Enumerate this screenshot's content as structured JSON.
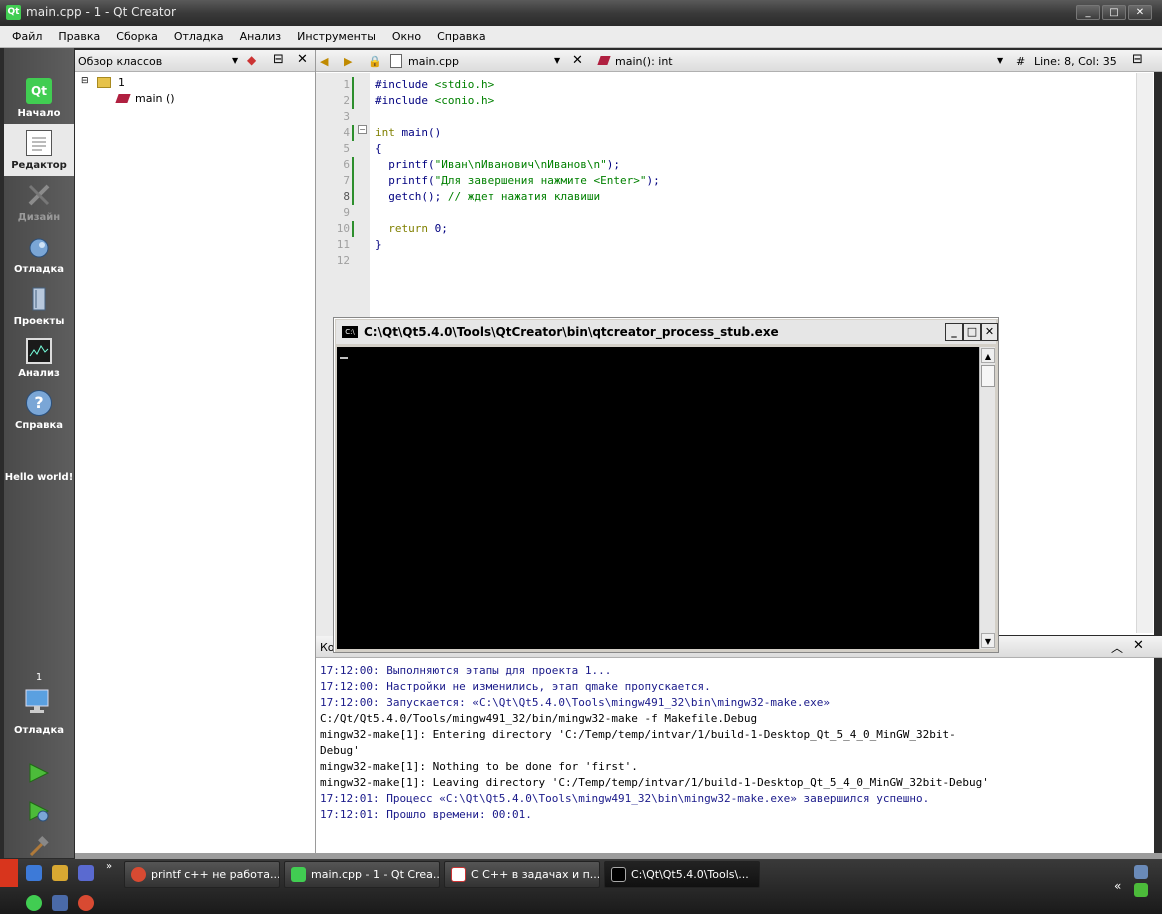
{
  "window": {
    "title": "main.cpp - 1 - Qt Creator",
    "app_icon_text": "Qt",
    "min": "_",
    "max": "□",
    "close": "✕"
  },
  "menu": [
    "Файл",
    "Правка",
    "Сборка",
    "Отладка",
    "Анализ",
    "Инструменты",
    "Окно",
    "Справка"
  ],
  "modes": [
    {
      "label": "Начало"
    },
    {
      "label": "Редактор"
    },
    {
      "label": "Дизайн"
    },
    {
      "label": "Отладка"
    },
    {
      "label": "Проекты"
    },
    {
      "label": "Анализ"
    },
    {
      "label": "Справка"
    }
  ],
  "hello": "Hello world!",
  "kit": {
    "number": "1",
    "label": "Отладка"
  },
  "classview": {
    "title": "Обзор классов",
    "root": "1",
    "child": "main ()"
  },
  "editor": {
    "file": "main.cpp",
    "symbol": "main(): int",
    "hash": "#",
    "position": "Line: 8, Col: 35",
    "line_numbers": [
      "1",
      "2",
      "3",
      "4",
      "5",
      "6",
      "7",
      "8",
      "9",
      "10",
      "11",
      "12"
    ],
    "lines": [
      "#include <stdio.h>",
      "#include <conio.h>",
      "",
      "int main()",
      "{",
      "  printf(\"Иван\\nИванович\\nИванов\\n\");",
      "  printf(\"Для завершения нажмите <Enter>\");",
      "  getch(); // ждет нажатия клавиши",
      "",
      "  return 0;",
      "}",
      ""
    ]
  },
  "console": {
    "title": "C:\\Qt\\Qt5.4.0\\Tools\\QtCreator\\bin\\qtcreator_process_stub.exe",
    "icon": "C:\\"
  },
  "output": {
    "tab": "Ко",
    "lines": [
      "17:12:00: Выполняются этапы для проекта 1...",
      "17:12:00: Настройки не изменились, этап qmake пропускается.",
      "17:12:00: Запускается: «C:\\Qt\\Qt5.4.0\\Tools\\mingw491_32\\bin\\mingw32-make.exe»",
      "C:/Qt/Qt5.4.0/Tools/mingw491_32/bin/mingw32-make -f Makefile.Debug",
      "mingw32-make[1]: Entering directory 'C:/Temp/temp/intvar/1/build-1-Desktop_Qt_5_4_0_MinGW_32bit-",
      "Debug'",
      "mingw32-make[1]: Nothing to be done for 'first'.",
      "mingw32-make[1]: Leaving directory 'C:/Temp/temp/intvar/1/build-1-Desktop_Qt_5_4_0_MinGW_32bit-Debug'",
      "17:12:01: Процесс «C:\\Qt\\Qt5.4.0\\Tools\\mingw491_32\\bin\\mingw32-make.exe» завершился успешно.",
      "17:12:01: Прошло времени: 00:01."
    ]
  },
  "taskbar": {
    "items": [
      {
        "label": "printf c++ не работа..."
      },
      {
        "label": "main.cpp - 1 - Qt Crea..."
      },
      {
        "label": "С C++ в задачах и п..."
      },
      {
        "label": "C:\\Qt\\Qt5.4.0\\Tools\\..."
      }
    ],
    "tray_text": "«"
  }
}
